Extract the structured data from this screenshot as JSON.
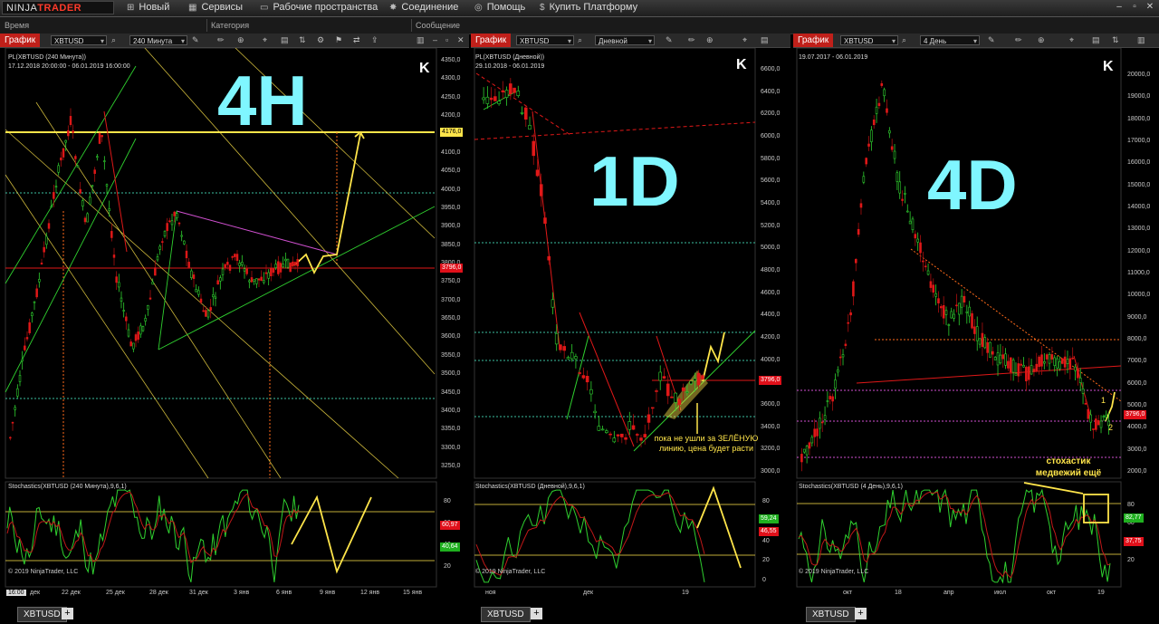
{
  "app": {
    "logo_prefix": "NINJA",
    "logo_suffix": "TRADER",
    "menu": [
      "Новый",
      "Сервисы",
      "Рабочие пространства",
      "Соединение",
      "Помощь",
      "Купить Платформу"
    ]
  },
  "log_columns": [
    "Время",
    "Категория",
    "Сообщение"
  ],
  "panels": [
    {
      "tab": "График",
      "instrument": "XBTUSD",
      "interval": "240 Минута",
      "title": "PL(XBTUSD (240 Минута))",
      "range": "17.12.2018 20:00:00 - 06.01.2019 16:00:00",
      "big_label": "4H",
      "price_axis": [
        "4350,0",
        "4300,0",
        "4250,0",
        "4200,0",
        "4150,0",
        "4100,0",
        "4050,0",
        "4000,0",
        "3950,0",
        "3900,0",
        "3850,0",
        "3800,0",
        "3750,0",
        "3700,0",
        "3650,0",
        "3600,0",
        "3550,0",
        "3500,0",
        "3450,0",
        "3400,0",
        "3350,0",
        "3300,0",
        "3250,0"
      ],
      "marker_price": "4176,0",
      "last_price": "3796,0",
      "stoch_title": "Stochastics(XBTUSD (240 Минута),9,6,1)",
      "stoch_axis": [
        "80",
        "60",
        "40",
        "20"
      ],
      "stoch_k": "60,97",
      "stoch_d": "40,64",
      "copyright": "© 2019 NinjaTrader, LLC",
      "time_axis": [
        "16:00",
        "дек",
        "22 дек",
        "25 дек",
        "28 дек",
        "31 дек",
        "3 янв",
        "6 янв",
        "9 янв",
        "12 янв",
        "15 янв"
      ]
    },
    {
      "tab": "График",
      "instrument": "XBTUSD",
      "interval": "Дневной",
      "title": "PL(XBTUSD (Дневной))",
      "range": "29.10.2018 - 06.01.2019",
      "big_label": "1D",
      "price_axis": [
        "6600,0",
        "6400,0",
        "6200,0",
        "6000,0",
        "5800,0",
        "5600,0",
        "5400,0",
        "5200,0",
        "5000,0",
        "4800,0",
        "4600,0",
        "4400,0",
        "4200,0",
        "4000,0",
        "3800,0",
        "3600,0",
        "3400,0",
        "3200,0",
        "3000,0"
      ],
      "last_price": "3796,0",
      "annotation": "пока не ушли за ЗЕЛЁНУЮ линию, цена будет расти",
      "stoch_title": "Stochastics(XBTUSD (Дневной),9,6,1)",
      "stoch_axis": [
        "80",
        "60",
        "40",
        "20",
        "0"
      ],
      "stoch_k": "59,24",
      "stoch_d": "46,55",
      "copyright": "© 2019 NinjaTrader, LLC",
      "time_axis": [
        "ноя",
        "дек",
        "19"
      ]
    },
    {
      "tab": "График",
      "instrument": "XBTUSD",
      "interval": "4 День",
      "title": "19.07.2017 - 06.01.2019",
      "big_label": "4D",
      "price_axis": [
        "20000,0",
        "19000,0",
        "18000,0",
        "17000,0",
        "16000,0",
        "15000,0",
        "14000,0",
        "13000,0",
        "12000,0",
        "11000,0",
        "10000,0",
        "9000,0",
        "8000,0",
        "7000,0",
        "6000,0",
        "5000,0",
        "4000,0",
        "3000,0",
        "2000,0"
      ],
      "last_price": "3796,0",
      "wave_labels": [
        "1",
        "2"
      ],
      "annotation": "стохастик медвежий ещё",
      "stoch_title": "Stochastics(XBTUSD (4 День),9,6,1)",
      "stoch_axis": [
        "80",
        "60",
        "40",
        "20"
      ],
      "stoch_k": "82,77",
      "stoch_d": "37,75",
      "copyright": "© 2019 NinjaTrader, LLC",
      "time_axis": [
        "окт",
        "18",
        "апр",
        "июл",
        "окт",
        "19"
      ]
    }
  ],
  "bottom_tabs": [
    "XBTUSD",
    "XBTUSD",
    "XBTUSD"
  ],
  "colors": {
    "accent_red": "#c0201a",
    "title_cyan": "#7ff6ff",
    "annotation_yellow": "#ffe54a",
    "candle_up": "#2fd02f",
    "candle_down": "#e01818"
  }
}
